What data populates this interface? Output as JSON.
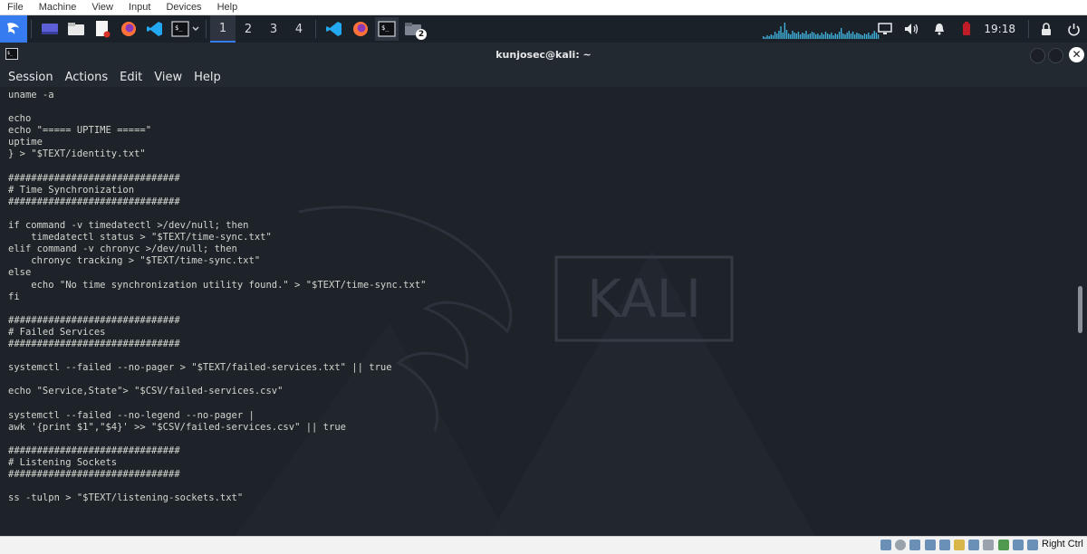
{
  "vbox": {
    "menu": [
      "File",
      "Machine",
      "View",
      "Input",
      "Devices",
      "Help"
    ],
    "status": {
      "host_key": "Right Ctrl"
    }
  },
  "panel": {
    "workspaces": [
      "1",
      "2",
      "3",
      "4"
    ],
    "active_workspace": "1",
    "clock": "19:18",
    "badge": "2",
    "accent": "#367bf0"
  },
  "terminal": {
    "title": "kunjosec@kali: ~",
    "menu": [
      "Session",
      "Actions",
      "Edit",
      "View",
      "Help"
    ],
    "watermark": "KALI",
    "content": "uname -a\n\necho\necho \"===== UPTIME =====\"\nuptime\n} > \"$TEXT/identity.txt\"\n\n##############################\n# Time Synchronization\n##############################\n\nif command -v timedatectl >/dev/null; then\n    timedatectl status > \"$TEXT/time-sync.txt\"\nelif command -v chronyc >/dev/null; then\n    chronyc tracking > \"$TEXT/time-sync.txt\"\nelse\n    echo \"No time synchronization utility found.\" > \"$TEXT/time-sync.txt\"\nfi\n\n##############################\n# Failed Services\n##############################\n\nsystemctl --failed --no-pager > \"$TEXT/failed-services.txt\" || true\n\necho \"Service,State\"> \"$CSV/failed-services.csv\"\n\nsystemctl --failed --no-legend --no-pager |\nawk '{print $1\",\"$4}' >> \"$CSV/failed-services.csv\" || true\n\n##############################\n# Listening Sockets\n##############################\n\nss -tulpn > \"$TEXT/listening-sockets.txt\""
  }
}
